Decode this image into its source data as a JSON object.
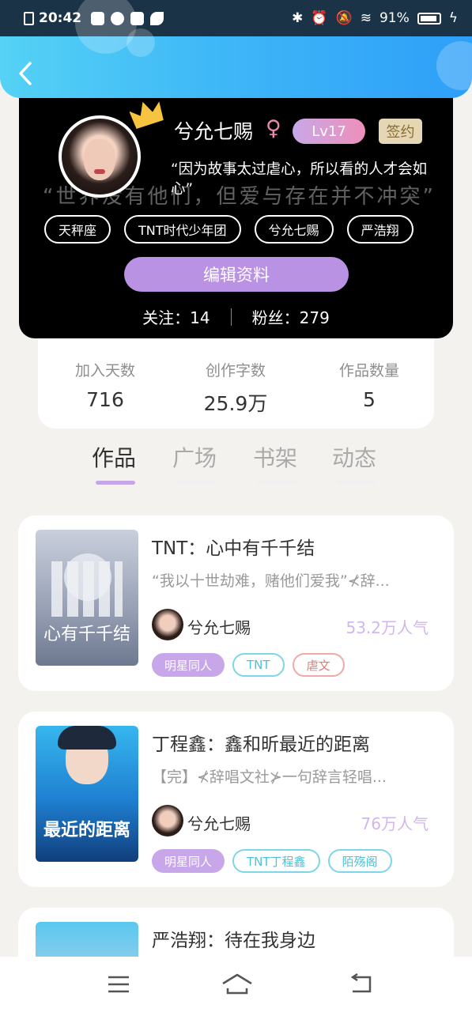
{
  "status_bar": {
    "time": "20:42",
    "battery": "91%"
  },
  "profile": {
    "name": "兮允七赐",
    "gender_symbol": "♀",
    "level": "Lv17",
    "signed": "签约",
    "bio": "“因为故事太过虐心，所以看的人才会如",
    "bio_line2": "心”",
    "background_quote": "“世界没有他们，但爱与存在并不冲突”",
    "tags": [
      "天秤座",
      "TNT时代少年团",
      "兮允七赐",
      "严浩翔"
    ],
    "edit_button": "编辑资料",
    "following": "关注：14",
    "followers": "粉丝：279"
  },
  "stats": [
    {
      "label": "加入天数",
      "value": "716"
    },
    {
      "label": "创作字数",
      "value": "25.9万"
    },
    {
      "label": "作品数量",
      "value": "5"
    }
  ],
  "tabs": [
    "作品",
    "广场",
    "书架",
    "动态"
  ],
  "books": [
    {
      "title": "TNT：心中有千千结",
      "desc": "“我以十世劫难，赌他们爱我”⊀辞...",
      "author": "兮允七赐",
      "popularity": "53.2万人气",
      "cover_text": "心有千千结",
      "tags": [
        "明星同人",
        "TNT",
        "虐文"
      ]
    },
    {
      "title": "丁程鑫：鑫和昕最近的距离",
      "desc": "【完】⊀辞唱文社⊁一句辞言轻唱...",
      "author": "兮允七赐",
      "popularity": "76万人气",
      "cover_text": "最近的距离",
      "tags": [
        "明星同人",
        "TNT丁程鑫",
        "陌殇阁"
      ]
    },
    {
      "title": "严浩翔：待在我身边"
    }
  ],
  "icons": {
    "back": "chevron-left-icon",
    "crown": "crown-icon",
    "nav_menu": "menu-icon",
    "nav_home": "home-icon",
    "nav_back": "back-icon"
  },
  "colors": {
    "accent": "#b992e4",
    "header_blue": "#3fb8f7"
  }
}
